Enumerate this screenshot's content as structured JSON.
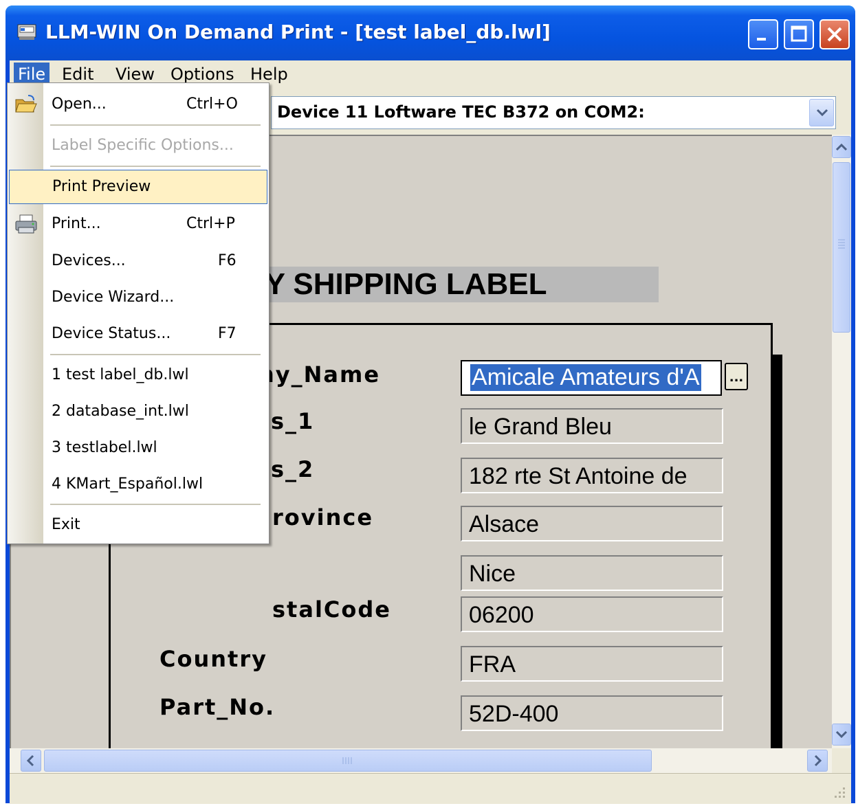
{
  "window": {
    "title": "LLM-WIN On Demand Print - [test label_db.lwl]"
  },
  "menubar": {
    "file": "File",
    "edit": "Edit",
    "view": "View",
    "options": "Options",
    "help": "Help"
  },
  "toolbar": {
    "device": "Device 11 Loftware TEC B372 on COM2:"
  },
  "file_menu": {
    "open": {
      "label": "Open...",
      "shortcut": "Ctrl+O"
    },
    "label_specific": {
      "label": "Label Specific Options..."
    },
    "print_preview": {
      "label": "Print Preview"
    },
    "print": {
      "label": "Print...",
      "shortcut": "Ctrl+P"
    },
    "devices": {
      "label": "Devices...",
      "shortcut": "F6"
    },
    "device_wizard": {
      "label": "Device Wizard..."
    },
    "device_status": {
      "label": "Device Status...",
      "shortcut": "F7"
    },
    "recent": [
      "1 test label_db.lwl",
      "2 database_int.lwl",
      "3 testlabel.lwl",
      "4 KMart_Español.lwl"
    ],
    "exit": {
      "label": "Exit"
    }
  },
  "label": {
    "title": "PANY SHIPPING LABEL",
    "field_labels": {
      "company_name": "ny_Name",
      "address_1": "s_1",
      "address_2": "s_2",
      "province": "rovince",
      "postal_code": "stalCode",
      "country": "Country",
      "part_no": "Part_No."
    },
    "values": {
      "company_name": "Amicale Amateurs d'A",
      "address_1": "le Grand Bleu",
      "address_2": "182 rte St Antoine de",
      "province": "Alsace",
      "city": "Nice",
      "postal_code": "06200",
      "country": "FRA",
      "part_no": "52D-400"
    },
    "lookup_button": "..."
  }
}
